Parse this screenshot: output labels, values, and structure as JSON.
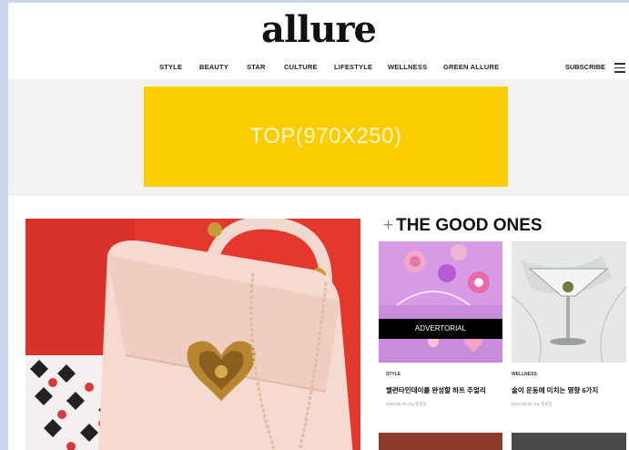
{
  "header": {
    "logo": "allure",
    "nav": [
      "STYLE",
      "BEAUTY",
      "STAR",
      "CULTURE",
      "LIFESTYLE",
      "WELLNESS",
      "GREEN ALLURE"
    ],
    "subscribe": "SUBSCRIBE"
  },
  "ad": {
    "label": "TOP(970X250)"
  },
  "section": {
    "title": "THE GOOD ONES",
    "plus": "+"
  },
  "cards": [
    {
      "badge": "ADVERTORIAL",
      "category": "STYLE",
      "title": "밸런타인데이를 완성할 하트 주얼리",
      "meta": "2024.00.00 | by 홍길동"
    },
    {
      "category": "WELLNESS",
      "title": "술이 운동에 미치는 영향 6가지",
      "meta": "2024.00.00 | by 홍길동"
    }
  ],
  "colors": {
    "ad_yellow": "#fbcc02",
    "hero_red": "#e33b2f",
    "card_purple": "#d99ae8"
  }
}
